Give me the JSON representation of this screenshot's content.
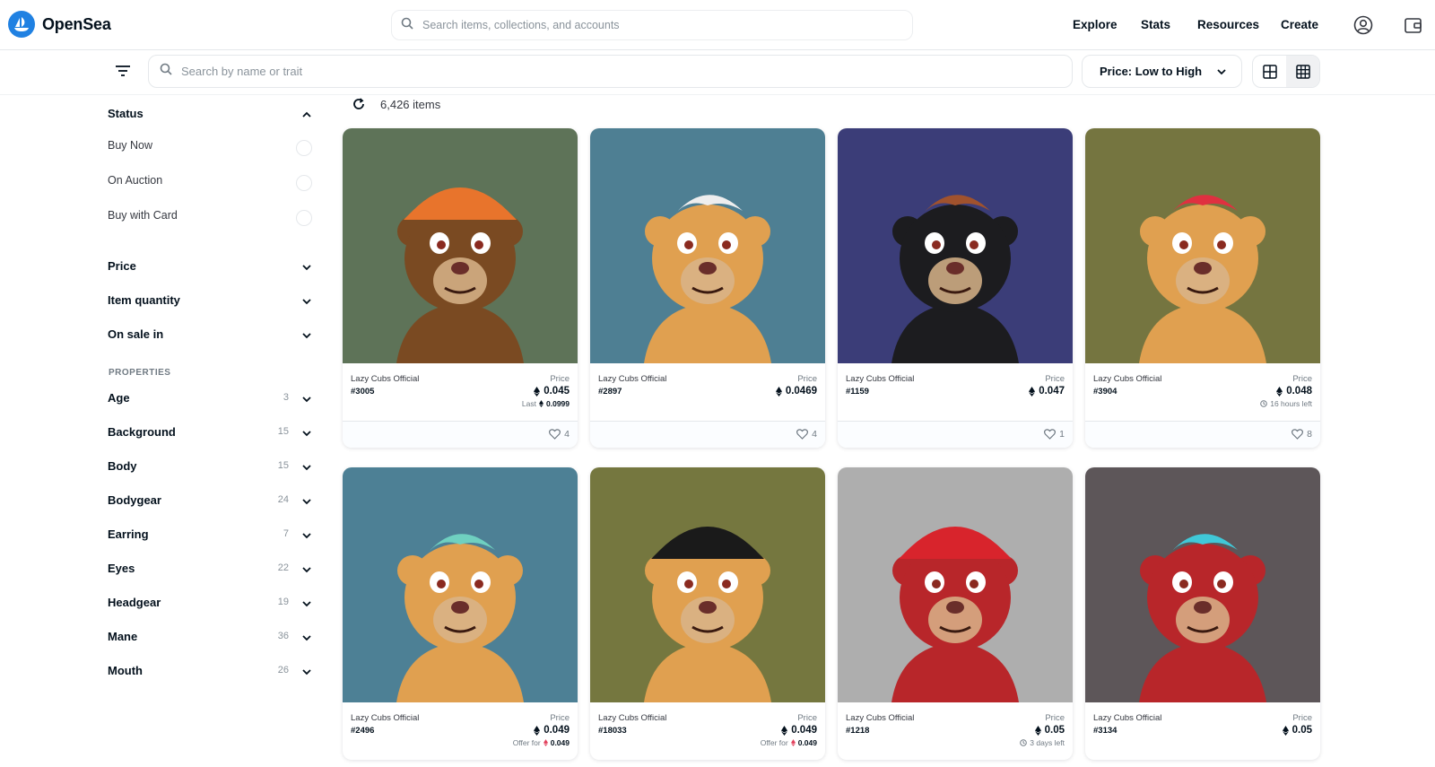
{
  "brand": {
    "name": "OpenSea",
    "accent": "#2081e2"
  },
  "top_nav": {
    "search_placeholder": "Search items, collections, and accounts",
    "links": [
      "Explore",
      "Stats",
      "Resources",
      "Create"
    ],
    "icons": [
      "account-icon",
      "wallet-icon"
    ]
  },
  "filter_bar": {
    "search_placeholder": "Search by name or trait",
    "sort_label": "Price: Low to High",
    "view_modes": [
      "large-grid",
      "small-grid"
    ],
    "active_view": "small-grid"
  },
  "sidebar": {
    "status": {
      "title": "Status",
      "options": [
        "Buy Now",
        "On Auction",
        "Buy with Card"
      ]
    },
    "sections": [
      "Price",
      "Item quantity",
      "On sale in"
    ],
    "properties_label": "PROPERTIES",
    "properties": [
      {
        "name": "Age",
        "count": "3"
      },
      {
        "name": "Background",
        "count": "15"
      },
      {
        "name": "Body",
        "count": "15"
      },
      {
        "name": "Bodygear",
        "count": "24"
      },
      {
        "name": "Earring",
        "count": "7"
      },
      {
        "name": "Eyes",
        "count": "22"
      },
      {
        "name": "Headgear",
        "count": "19"
      },
      {
        "name": "Mane",
        "count": "36"
      },
      {
        "name": "Mouth",
        "count": "26"
      }
    ]
  },
  "results": {
    "count_label": "6,426 items"
  },
  "cards": [
    {
      "collection": "Lazy Cubs Official",
      "id": "#3005",
      "price_label": "Price",
      "price": "0.045",
      "sub_prefix": "Last",
      "sub_value": "0.0999",
      "sub_kind": "last",
      "likes": "4",
      "bg": "#5e7358",
      "fur": "#7a4a22",
      "hat": "#e8742c",
      "mane": "#6fd0c0"
    },
    {
      "collection": "Lazy Cubs Official",
      "id": "#2897",
      "price_label": "Price",
      "price": "0.0469",
      "sub_prefix": "",
      "sub_value": "",
      "sub_kind": "none",
      "likes": "4",
      "bg": "#4e7f93",
      "fur": "#e0a050",
      "hat": "",
      "mane": "#eeeeee"
    },
    {
      "collection": "Lazy Cubs Official",
      "id": "#1159",
      "price_label": "Price",
      "price": "0.047",
      "sub_prefix": "",
      "sub_value": "",
      "sub_kind": "none",
      "likes": "1",
      "bg": "#3b3d78",
      "fur": "#1c1c1f",
      "hat": "",
      "mane": "#a0522d"
    },
    {
      "collection": "Lazy Cubs Official",
      "id": "#3904",
      "price_label": "Price",
      "price": "0.048",
      "sub_prefix": "16 hours left",
      "sub_value": "",
      "sub_kind": "time",
      "likes": "8",
      "bg": "#757540",
      "fur": "#e0a050",
      "hat": "",
      "mane": "#e03040"
    },
    {
      "collection": "Lazy Cubs Official",
      "id": "#2496",
      "price_label": "Price",
      "price": "0.049",
      "sub_prefix": "Offer for",
      "sub_value": "0.049",
      "sub_kind": "offer",
      "likes": "",
      "bg": "#4d8095",
      "fur": "#e0a050",
      "hat": "",
      "mane": "#6fd0c0"
    },
    {
      "collection": "Lazy Cubs Official",
      "id": "#18033",
      "price_label": "Price",
      "price": "0.049",
      "sub_prefix": "Offer for",
      "sub_value": "0.049",
      "sub_kind": "offer",
      "likes": "",
      "bg": "#75773f",
      "fur": "#e0a050",
      "hat": "#1a1a1a",
      "mane": "#7a5bd0"
    },
    {
      "collection": "Lazy Cubs Official",
      "id": "#1218",
      "price_label": "Price",
      "price": "0.05",
      "sub_prefix": "3 days left",
      "sub_value": "",
      "sub_kind": "time",
      "likes": "",
      "bg": "#aeaeae",
      "fur": "#b8262a",
      "hat": "#d8242c",
      "mane": "#6fd0c0"
    },
    {
      "collection": "Lazy Cubs Official",
      "id": "#3134",
      "price_label": "Price",
      "price": "0.05",
      "sub_prefix": "",
      "sub_value": "",
      "sub_kind": "none",
      "likes": "",
      "bg": "#5d5659",
      "fur": "#b8262a",
      "hat": "",
      "mane": "#40c8d8"
    }
  ]
}
